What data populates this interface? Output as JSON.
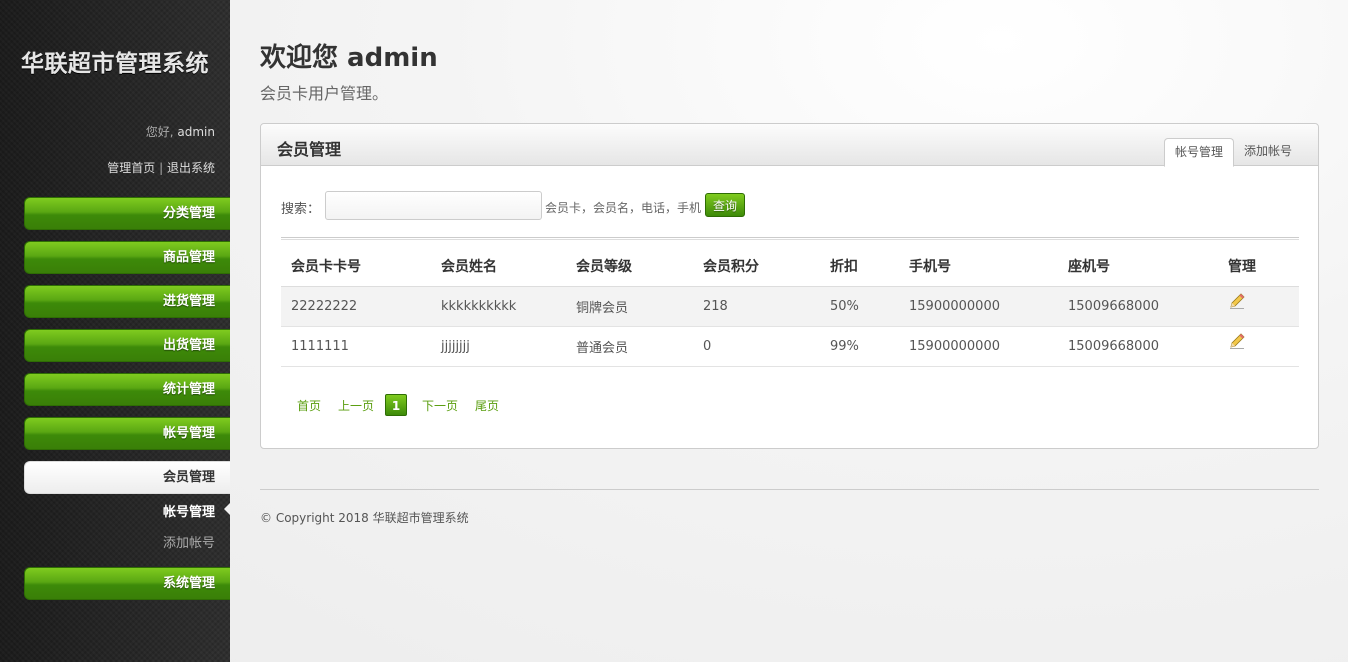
{
  "sidebar": {
    "site_title": "华联超市管理系统",
    "greeting_prefix": "您好, ",
    "username": "admin",
    "links": {
      "home": "管理首页",
      "separator": " | ",
      "logout": "退出系统"
    },
    "nav": [
      {
        "label": "分类管理"
      },
      {
        "label": "商品管理"
      },
      {
        "label": "进货管理"
      },
      {
        "label": "出货管理"
      },
      {
        "label": "统计管理"
      },
      {
        "label": "帐号管理"
      },
      {
        "label": "会员管理"
      },
      {
        "label": "系统管理"
      }
    ],
    "active_nav": "会员管理",
    "subnav": [
      {
        "label": "帐号管理",
        "current": true
      },
      {
        "label": "添加帐号",
        "current": false
      }
    ]
  },
  "header": {
    "welcome": "欢迎您 admin",
    "subtitle": "会员卡用户管理。"
  },
  "box": {
    "title": "会员管理",
    "tabs": [
      {
        "label": "帐号管理",
        "active": true
      },
      {
        "label": "添加帐号",
        "active": false
      }
    ]
  },
  "search": {
    "label": "搜索：",
    "value": "",
    "placeholder": "",
    "hint": "会员卡，会员名，电话，手机",
    "button": "查询"
  },
  "table": {
    "columns": [
      "会员卡卡号",
      "会员姓名",
      "会员等级",
      "会员积分",
      "折扣",
      "手机号",
      "座机号",
      "管理"
    ],
    "rows": [
      [
        "22222222",
        "kkkkkkkkkk",
        "铜牌会员",
        "218",
        "50%",
        "15900000000",
        "15009668000"
      ],
      [
        "1111111",
        "jjjjjjjj",
        "普通会员",
        "0",
        "99%",
        "15900000000",
        "15009668000"
      ]
    ]
  },
  "pagination": {
    "first": "首页",
    "prev": "上一页",
    "current": "1",
    "next": "下一页",
    "last": "尾页"
  },
  "footer": {
    "copyright": "© Copyright 2018 华联超市管理系统"
  },
  "colors": {
    "accent_green": "#5aa713",
    "sidebar_bg": "#2a2a2a"
  },
  "icons": {
    "edit": "pencil-icon"
  }
}
